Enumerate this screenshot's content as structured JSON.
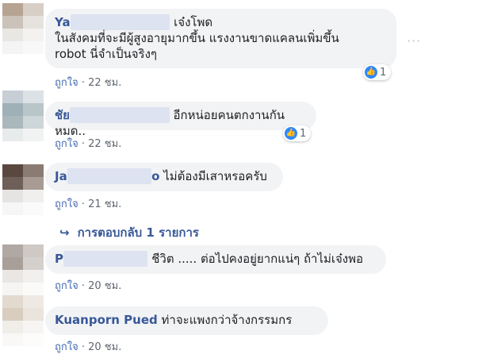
{
  "comments": [
    {
      "name_visible": "Ya",
      "text": "เจ๋งโพด",
      "text2": "ในสังคมที่จะมีผู้สูงอายุมากขึ้น แรงงานขาดแคลนเพิ่มขึ้น",
      "text3": "robot นี่จำเป็นจริงๆ",
      "like_label": "ถูกใจ",
      "time": "· 22 ชม.",
      "reaction_count": "1"
    },
    {
      "name_visible": "ชัย",
      "text": "อีกหน่อยคนตกงานกันหมด..",
      "like_label": "ถูกใจ",
      "time": "· 22 ชม.",
      "reaction_count": "1"
    },
    {
      "name_visible": "Ja",
      "name_end": "o",
      "text": "ไม่ต้องมีเสาหรอครับ",
      "like_label": "ถูกใจ",
      "time": "· 21 ชม."
    },
    {
      "name_visible": "P",
      "text": "ชีวิต ..... ต่อไปคงอยู่ยากแน่ๆ ถ้าไม่เจ๋งพอ",
      "like_label": "ถูกใจ",
      "time": "· 20 ชม."
    },
    {
      "name_visible": "Kuanporn Pued",
      "text": "ท่าจะแพงกว่าจ้างกรรมกร",
      "like_label": "ถูกใจ",
      "time": "· 20 ชม."
    }
  ],
  "replies_link": "การตอบกลับ 1 รายการ",
  "more_options": "···"
}
